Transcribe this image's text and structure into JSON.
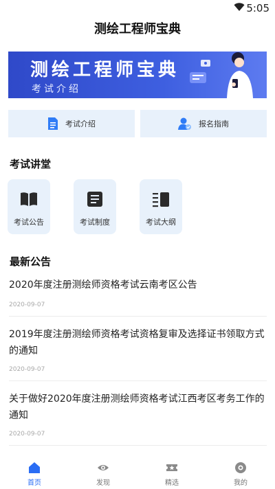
{
  "status": {
    "time": "5:05"
  },
  "app": {
    "title": "测绘工程师宝典"
  },
  "banner": {
    "title": "测绘工程师宝典",
    "subtitle": "考试介绍"
  },
  "quick_links": [
    {
      "label": "考试介绍",
      "icon": "document-icon"
    },
    {
      "label": "报名指南",
      "icon": "user-badge-icon"
    }
  ],
  "lecture": {
    "title": "考试讲堂",
    "tiles": [
      {
        "label": "考试公告",
        "icon": "book-icon"
      },
      {
        "label": "考试制度",
        "icon": "note-icon"
      },
      {
        "label": "考试大纲",
        "icon": "outline-icon"
      }
    ]
  },
  "news": {
    "title": "最新公告",
    "items": [
      {
        "title": "2020年度注册测绘师资格考试云南考区公告",
        "date": "2020-09-07"
      },
      {
        "title": "2019年度注册测绘师资格考试资格复审及选择证书领取方式的通知",
        "date": "2020-09-07"
      },
      {
        "title": "关于做好2020年度注册测绘师资格考试江西考区考务工作的通知",
        "date": "2020-09-07"
      }
    ]
  },
  "tabs": [
    {
      "label": "首页",
      "icon": "home-icon",
      "active": true
    },
    {
      "label": "发现",
      "icon": "eye-icon",
      "active": false
    },
    {
      "label": "精选",
      "icon": "star-ticket-icon",
      "active": false
    },
    {
      "label": "我的",
      "icon": "profile-icon",
      "active": false
    }
  ],
  "colors": {
    "accent": "#2a6df4",
    "tile_bg": "#e8f1fb",
    "banner": "#3e5fe0"
  }
}
